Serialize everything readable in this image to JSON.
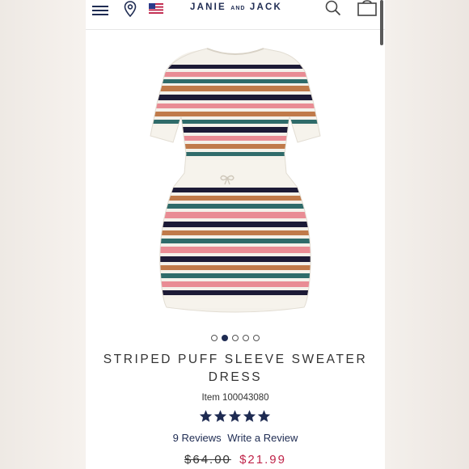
{
  "header": {
    "brand_main": "JANIE",
    "brand_and": "AND",
    "brand_end": "JACK",
    "menu_icon": "hamburger-menu-icon",
    "location_icon": "location-pin-icon",
    "flag_icon": "us-flag-icon",
    "search_icon": "search-icon",
    "bag_icon": "shopping-bag-icon"
  },
  "product": {
    "image_icon": "striped-sweater-dress-image",
    "title_line1": "STRIPED PUFF SLEEVE SWEATER",
    "title_line2": "DRESS",
    "item_number": "Item 100043080",
    "rating": 5,
    "reviews_link": "9 Reviews",
    "write_review_link": "Write a Review",
    "price_original": "$64.00",
    "price_sale": "$21.99"
  },
  "carousel": {
    "count": 5,
    "active_index": 1
  },
  "colors": {
    "navy": "#1e2b52",
    "sale_red": "#c0254a",
    "stripe_pink": "#e98c94",
    "stripe_tan": "#c07a4a",
    "stripe_teal": "#2f6b6a",
    "stripe_navy": "#1c1a36",
    "knit_cream": "#f4f1ea"
  }
}
